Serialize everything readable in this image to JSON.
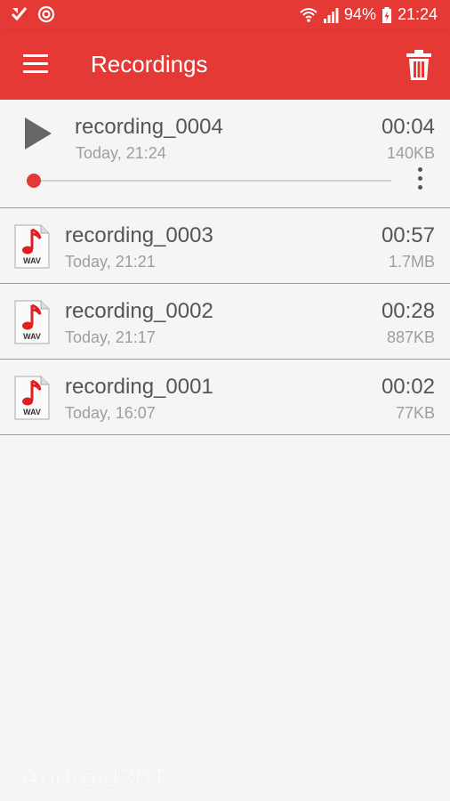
{
  "status_bar": {
    "battery": "94%",
    "time": "21:24"
  },
  "app_bar": {
    "title": "Recordings"
  },
  "recordings": [
    {
      "name": "recording_0004",
      "date": "Today, 21:24",
      "duration": "00:04",
      "size": "140KB",
      "expanded": true,
      "progress": 0
    },
    {
      "name": "recording_0003",
      "date": "Today, 21:21",
      "duration": "00:57",
      "size": "1.7MB"
    },
    {
      "name": "recording_0002",
      "date": "Today, 21:17",
      "duration": "00:28",
      "size": "887KB"
    },
    {
      "name": "recording_0001",
      "date": "Today, 16:07",
      "duration": "00:02",
      "size": "77KB"
    }
  ],
  "file_icon_label": "WAV",
  "watermark": "Android30T",
  "colors": {
    "accent": "#e53935",
    "text": "#555555",
    "secondary": "#9e9e9e"
  }
}
